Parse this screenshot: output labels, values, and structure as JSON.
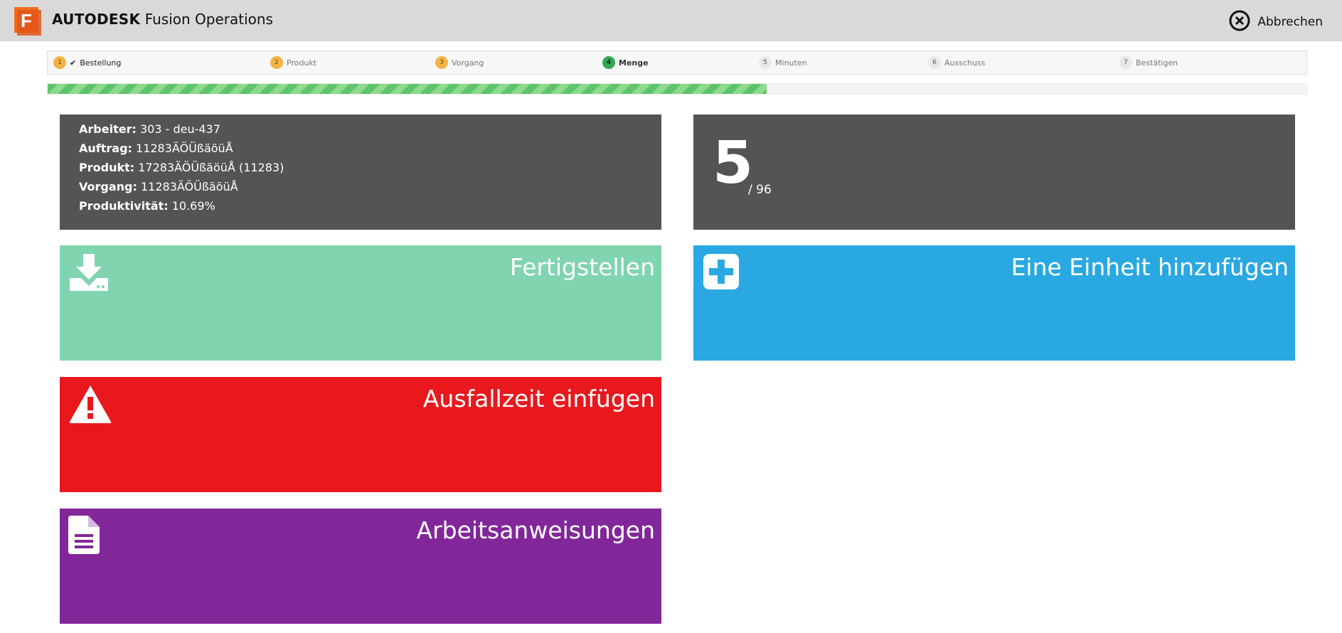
{
  "header": {
    "brand_strong": "AUTODESK",
    "brand_rest": "Fusion Operations",
    "logo_letter": "F",
    "cancel_label": "Abbrechen",
    "colors": {
      "bar": "#d9d9d9",
      "logo": "#f26b1d"
    }
  },
  "steps": [
    {
      "num": "1",
      "label": "Bestellung",
      "state": "done"
    },
    {
      "num": "2",
      "label": "Produkt",
      "state": "done"
    },
    {
      "num": "3",
      "label": "Vorgang",
      "state": "done"
    },
    {
      "num": "4",
      "label": "Menge",
      "state": "current"
    },
    {
      "num": "5",
      "label": "Minuten",
      "state": "pending"
    },
    {
      "num": "6",
      "label": "Ausschuss",
      "state": "pending"
    },
    {
      "num": "7",
      "label": "Bestätigen",
      "state": "pending"
    }
  ],
  "progress": {
    "fraction": 0.571
  },
  "info": {
    "worker_label": "Arbeiter:",
    "worker_value": "303 - deu-437",
    "order_label": "Auftrag:",
    "order_value": "11283ÄÖÜßäöüÅ",
    "product_label": "Produkt:",
    "product_value": "17283ÄÖÜßäöüÅ (11283)",
    "operation_label": "Vorgang:",
    "operation_value": "11283ÄÖÜßäöüÅ",
    "productivity_label": "Produktivität:",
    "productivity_value": "10.69%"
  },
  "counter": {
    "current": "5",
    "total": "/ 96"
  },
  "tiles": {
    "finish": {
      "label": "Fertigstellen",
      "color": "#80d4b0",
      "icon": "download-icon"
    },
    "add_unit": {
      "label": "Eine Einheit hinzufügen",
      "color": "#29a8e1",
      "icon": "plus-square-icon"
    },
    "downtime": {
      "label": "Ausfallzeit einfügen",
      "color": "#e8181d",
      "icon": "warning-icon"
    },
    "instructions": {
      "label": "Arbeitsanweisungen",
      "color": "#82279a",
      "icon": "document-icon"
    }
  }
}
